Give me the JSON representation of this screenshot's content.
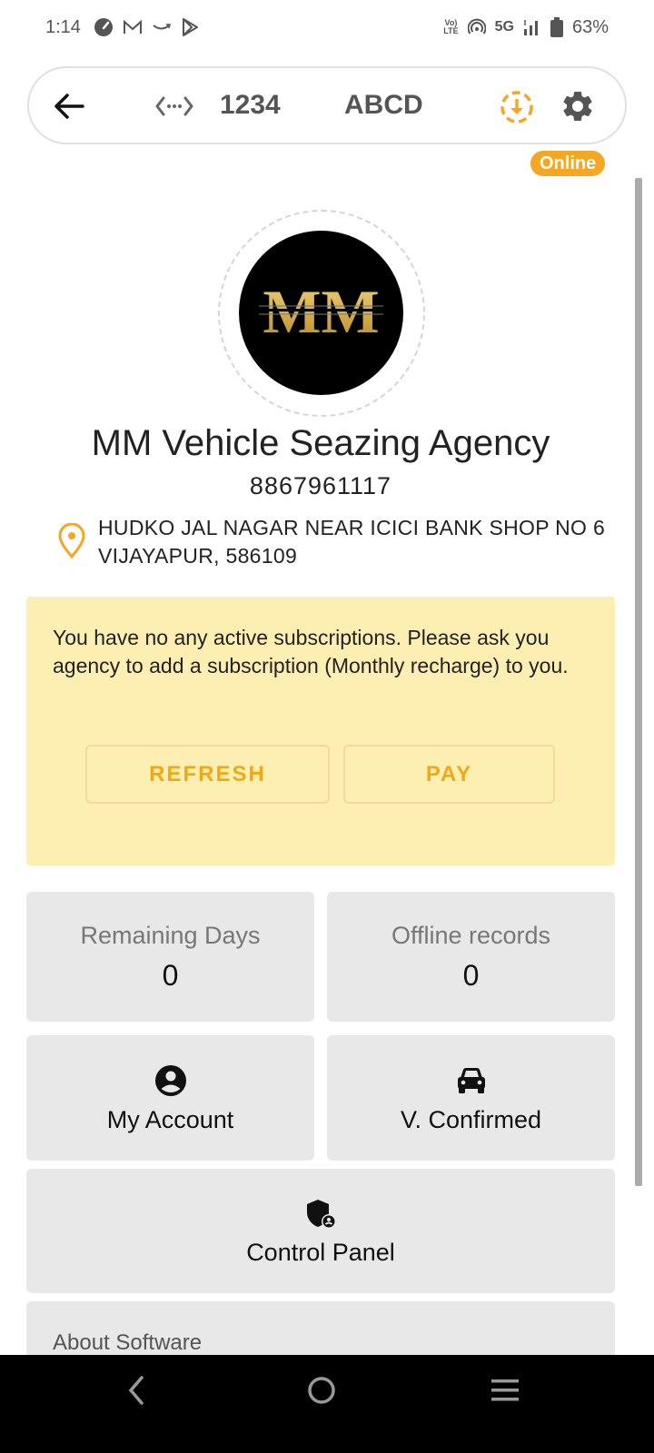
{
  "status_bar": {
    "time": "1:14",
    "notification_icons": [
      "speedometer-icon",
      "gmail-icon",
      "amazon-icon",
      "play-store-icon"
    ],
    "volte_line1": "Vo)",
    "volte_line2": "LTE",
    "network": "5G",
    "battery_percent": "63%"
  },
  "header": {
    "device_id": "1234",
    "device_name": "ABCD",
    "status_badge": "Online",
    "accent_color": "#f5a623"
  },
  "profile": {
    "logo_text": "MM",
    "agency_name": "MM Vehicle Seazing Agency",
    "phone": "8867961117",
    "address": "HUDKO JAL NAGAR NEAR ICICI BANK SHOP NO 6 VIJAYAPUR, 586109"
  },
  "subscription_notice": {
    "message": "You have no any active subscriptions. Please ask you agency to add a subscription (Monthly recharge) to you.",
    "refresh_label": "REFRESH",
    "pay_label": "PAY"
  },
  "stats": [
    {
      "label": "Remaining Days",
      "value": "0"
    },
    {
      "label": "Offline records",
      "value": "0"
    }
  ],
  "menu": {
    "my_account": "My Account",
    "vehicles_confirmed": "V. Confirmed",
    "control_panel": "Control Panel",
    "about": "About Software"
  }
}
